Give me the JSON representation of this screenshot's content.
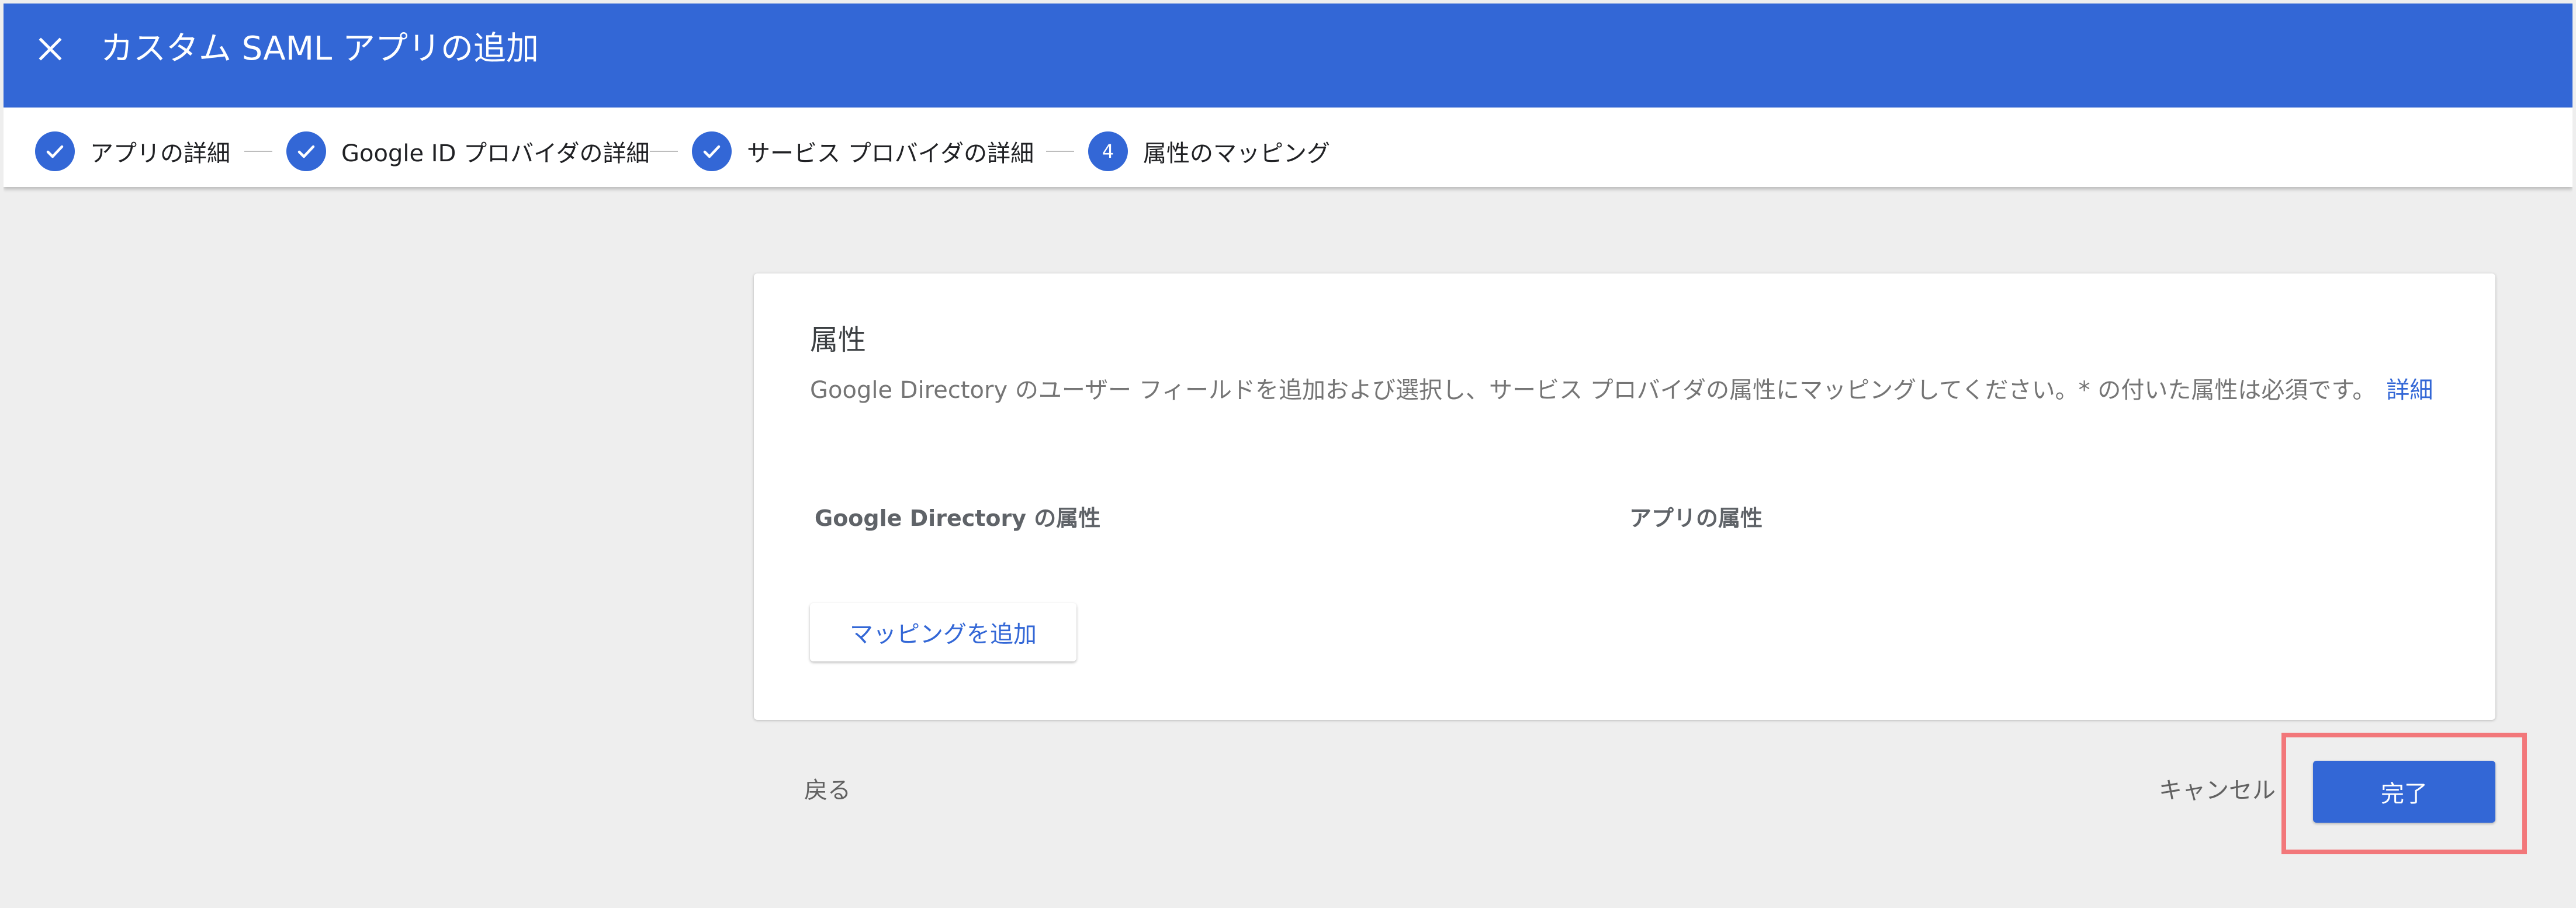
{
  "window": {
    "title": "カスタム SAML アプリの追加",
    "close_icon": "close-icon",
    "accent": "#3367d6",
    "highlight": "#f2777a"
  },
  "stepper": {
    "steps": [
      {
        "label": "アプリの詳細",
        "state": "completed",
        "icon": "check-icon"
      },
      {
        "label": "Google ID プロバイダの詳細",
        "state": "completed",
        "icon": "check-icon"
      },
      {
        "label": "サービス プロバイダの詳細",
        "state": "completed",
        "icon": "check-icon"
      },
      {
        "label": "属性のマッピング",
        "state": "current",
        "number": "4"
      }
    ]
  },
  "card": {
    "title": "属性",
    "description": "Google Directory のユーザー フィールドを追加および選択し、サービス プロバイダの属性にマッピングしてください。* の付いた属性は必須です。",
    "learn_more": "詳細",
    "columns": {
      "directory": "Google Directory の属性",
      "app": "アプリの属性"
    },
    "add_mapping_label": "マッピングを追加"
  },
  "footer": {
    "back_label": "戻る",
    "cancel_label": "キャンセル",
    "done_label": "完了"
  }
}
